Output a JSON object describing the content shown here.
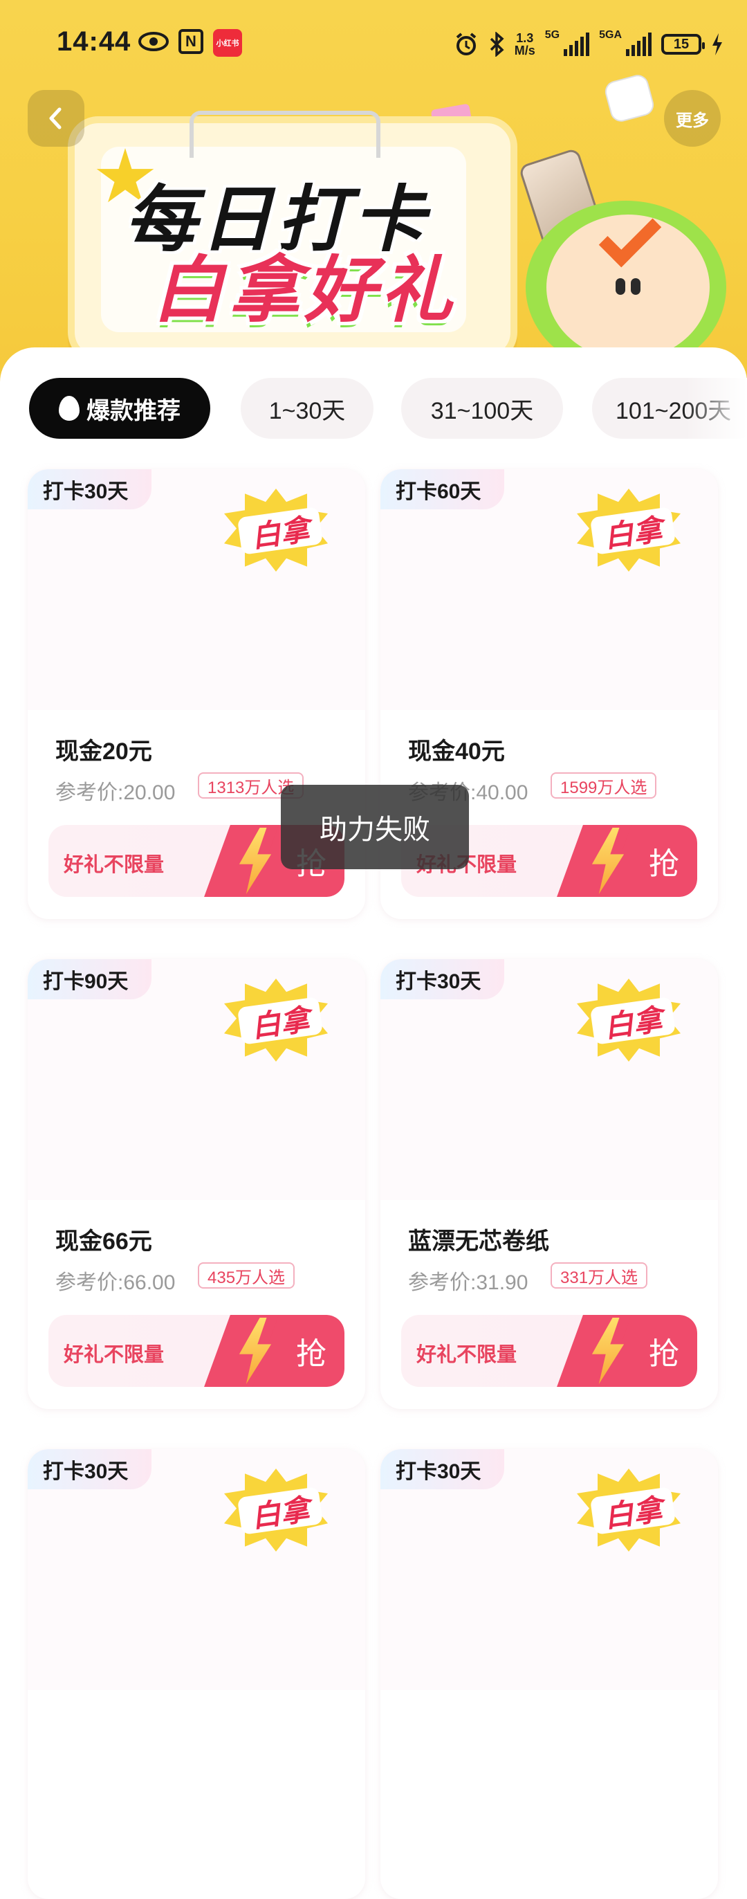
{
  "status_bar": {
    "time": "14:44",
    "app_badge": "小红书",
    "speed_value": "1.3",
    "speed_unit": "M/s",
    "net1": "5G",
    "net2": "5GA",
    "battery": "15"
  },
  "header": {
    "more_label": "更多",
    "banner_line1": "每日打卡",
    "banner_line2": "白拿好礼"
  },
  "tabs": [
    {
      "label": "爆款推荐",
      "active": true
    },
    {
      "label": "1~30天",
      "active": false
    },
    {
      "label": "31~100天",
      "active": false
    },
    {
      "label": "101~200天",
      "active": false
    }
  ],
  "products": [
    {
      "day_tag": "打卡30天",
      "stamp": "白拿",
      "title": "现金20元",
      "price": "参考价:20.00",
      "picked": "1313万人选",
      "buy_label": "好礼不限量",
      "grab_label": "抢"
    },
    {
      "day_tag": "打卡60天",
      "stamp": "白拿",
      "title": "现金40元",
      "price": "参考价:40.00",
      "picked": "1599万人选",
      "buy_label": "好礼不限量",
      "grab_label": "抢"
    },
    {
      "day_tag": "打卡90天",
      "stamp": "白拿",
      "title": "现金66元",
      "price": "参考价:66.00",
      "picked": "435万人选",
      "buy_label": "好礼不限量",
      "grab_label": "抢"
    },
    {
      "day_tag": "打卡30天",
      "stamp": "白拿",
      "title": "蓝漂无芯卷纸",
      "price": "参考价:31.90",
      "picked": "331万人选",
      "buy_label": "好礼不限量",
      "grab_label": "抢"
    },
    {
      "day_tag": "打卡30天",
      "stamp": "白拿"
    },
    {
      "day_tag": "打卡30天",
      "stamp": "白拿"
    }
  ],
  "toast": "助力失败",
  "colors": {
    "header_yellow": "#f8d44e",
    "accent_red": "#ef4b6b",
    "tag_text": "#e8445f"
  }
}
